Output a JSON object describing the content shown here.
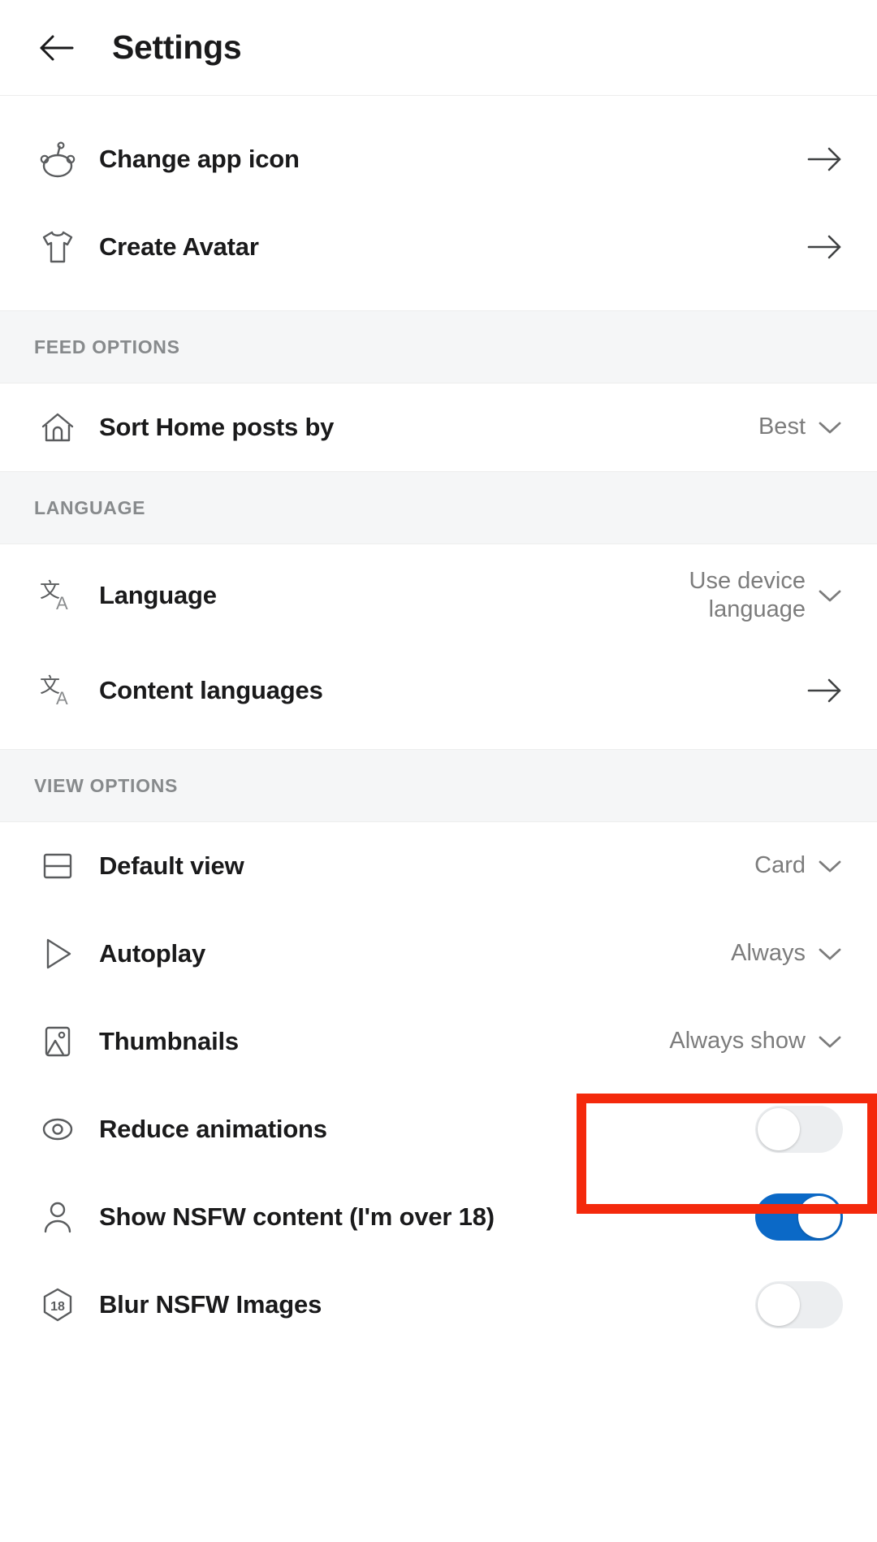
{
  "header": {
    "title": "Settings",
    "back_icon": "arrow-left-icon"
  },
  "sections": [
    {
      "id": "top",
      "header": null,
      "rows": [
        {
          "id": "change-app-icon",
          "icon": "snoo-icon",
          "label": "Change app icon",
          "control": "arrow",
          "value": ""
        },
        {
          "id": "create-avatar",
          "icon": "tshirt-icon",
          "label": "Create Avatar",
          "control": "arrow",
          "value": ""
        }
      ]
    },
    {
      "id": "feed-options",
      "header": "FEED OPTIONS",
      "rows": [
        {
          "id": "sort-home-posts-by",
          "icon": "home-icon",
          "label": "Sort Home posts by",
          "control": "dropdown",
          "value": "Best"
        }
      ]
    },
    {
      "id": "language",
      "header": "LANGUAGE",
      "rows": [
        {
          "id": "language",
          "icon": "translate-icon",
          "label": "Language",
          "control": "dropdown",
          "value": "Use device language"
        },
        {
          "id": "content-languages",
          "icon": "translate-icon",
          "label": "Content languages",
          "control": "arrow",
          "value": ""
        }
      ]
    },
    {
      "id": "view-options",
      "header": "VIEW OPTIONS",
      "rows": [
        {
          "id": "default-view",
          "icon": "card-view-icon",
          "label": "Default view",
          "control": "dropdown",
          "value": "Card"
        },
        {
          "id": "autoplay",
          "icon": "play-icon",
          "label": "Autoplay",
          "control": "dropdown",
          "value": "Always"
        },
        {
          "id": "thumbnails",
          "icon": "image-icon",
          "label": "Thumbnails",
          "control": "dropdown",
          "value": "Always show"
        },
        {
          "id": "reduce-animations",
          "icon": "motion-icon",
          "label": "Reduce animations",
          "control": "toggle",
          "toggle_on": false,
          "value": ""
        },
        {
          "id": "show-nsfw-content",
          "icon": "person-icon",
          "label": "Show NSFW content (I'm over 18)",
          "control": "toggle",
          "toggle_on": true,
          "value": ""
        },
        {
          "id": "blur-nsfw-images",
          "icon": "age-18-icon",
          "label": "Blur NSFW Images",
          "control": "toggle",
          "toggle_on": false,
          "value": ""
        }
      ]
    }
  ],
  "colors": {
    "toggle_on": "#0b69c7",
    "toggle_off": "#eceef0",
    "highlight": "#f4290c",
    "section_bg": "#f5f6f7",
    "label": "#1a1a1b",
    "value": "#7c7c7c"
  },
  "annotation": {
    "target": "show-nsfw-content-toggle",
    "style": "red-rectangle-highlight"
  }
}
